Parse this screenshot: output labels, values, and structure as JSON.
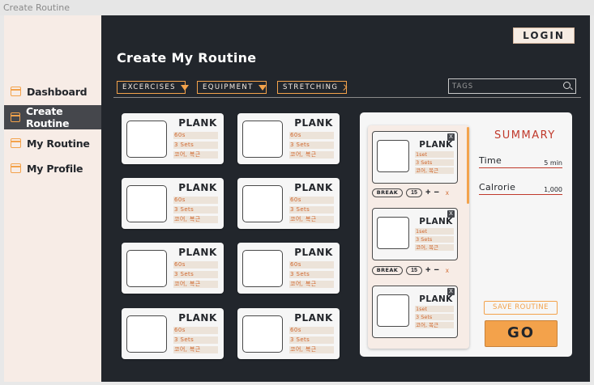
{
  "window": {
    "title": "Create Routine"
  },
  "sidebar": {
    "items": [
      {
        "label": "Dashboard",
        "icon": "folder-icon"
      },
      {
        "label": "Create Routine",
        "icon": "folder-icon",
        "active": true
      },
      {
        "label": "My Routine",
        "icon": "folder-icon"
      },
      {
        "label": "My Profile",
        "icon": "folder-icon"
      }
    ]
  },
  "header": {
    "login_label": "LOGIN",
    "page_title": "Create My Routine"
  },
  "filters": {
    "exercises": "EXCERCISES",
    "equipment": "EQUIPMENT",
    "stretching": "STRETCHING",
    "tags_placeholder": "TAGS"
  },
  "exercise_cards": [
    {
      "name": "PLANK",
      "duration": "60s",
      "sets": "3 Sets",
      "tags": "코어, 복근"
    },
    {
      "name": "PLANK",
      "duration": "60s",
      "sets": "3 Sets",
      "tags": "코어, 복근"
    },
    {
      "name": "PLANK",
      "duration": "60s",
      "sets": "3 Sets",
      "tags": "코어, 복근"
    },
    {
      "name": "PLANK",
      "duration": "60s",
      "sets": "3 Sets",
      "tags": "코어, 복근"
    },
    {
      "name": "PLANK",
      "duration": "60s",
      "sets": "3 Sets",
      "tags": "코어, 복근"
    },
    {
      "name": "PLANK",
      "duration": "60s",
      "sets": "3 Sets",
      "tags": "코어, 복근"
    },
    {
      "name": "PLANK",
      "duration": "60s",
      "sets": "3 Sets",
      "tags": "코어, 복근"
    },
    {
      "name": "PLANK",
      "duration": "60s",
      "sets": "3 Sets",
      "tags": "코어, 복근"
    }
  ],
  "routine": {
    "items": [
      {
        "name": "PLANK",
        "set": "1set",
        "sets": "3 Sets",
        "tags": "코어, 복근",
        "close": "X"
      },
      {
        "name": "PLANK",
        "set": "1set",
        "sets": "3 Sets",
        "tags": "코어, 복근",
        "close": "X"
      },
      {
        "name": "PLANK",
        "set": "1set",
        "sets": "3 Sets",
        "tags": "코어, 복근",
        "close": "X"
      }
    ],
    "breaks": [
      {
        "label": "BREAK",
        "value": "15",
        "plus": "+",
        "minus": "−",
        "remove": "x"
      },
      {
        "label": "BREAK",
        "value": "15",
        "plus": "+",
        "minus": "−",
        "remove": "x"
      }
    ]
  },
  "summary": {
    "title": "SUMMARY",
    "time_label": "Time",
    "time_value": "5 min",
    "calorie_label": "Calrorie",
    "calorie_value": "1,000",
    "save_label": "SAVE ROUTINE",
    "go_label": "GO"
  },
  "colors": {
    "accent": "#f3a24b",
    "sidebar_bg": "#f7ece6",
    "main_bg": "#22262c",
    "summary_red": "#c0392b"
  }
}
